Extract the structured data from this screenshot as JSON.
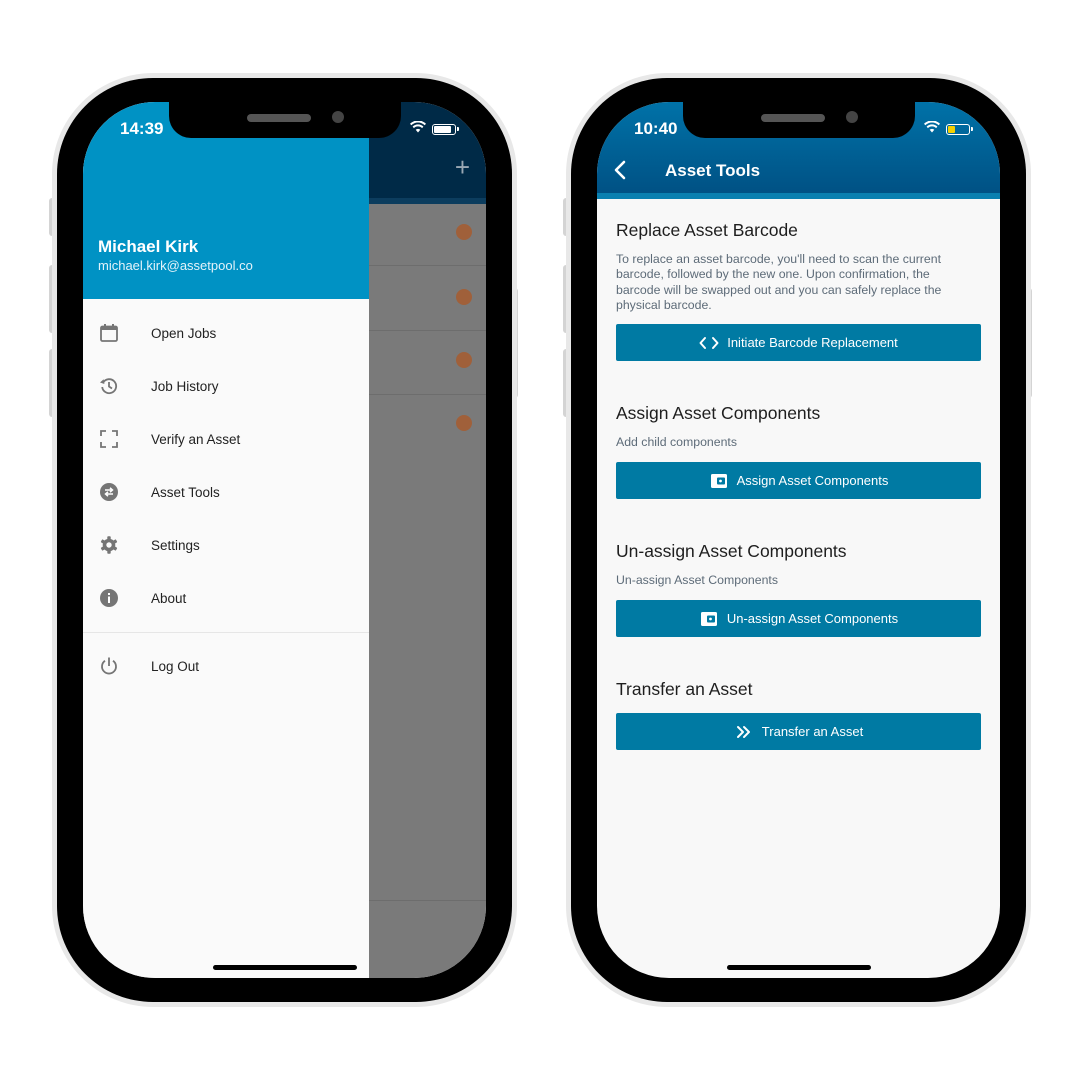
{
  "left_phone": {
    "status_time": "14:39",
    "drawer": {
      "user_name": "Michael Kirk",
      "user_email": "michael.kirk@assetpool.co",
      "menu": [
        {
          "label": "Open Jobs",
          "icon": "calendar-icon"
        },
        {
          "label": "Job History",
          "icon": "history-icon"
        },
        {
          "label": "Verify an Asset",
          "icon": "scan-frame-icon"
        },
        {
          "label": "Asset Tools",
          "icon": "swap-circle-icon"
        },
        {
          "label": "Settings",
          "icon": "gear-icon"
        },
        {
          "label": "About",
          "icon": "info-icon"
        }
      ],
      "logout": {
        "label": "Log Out",
        "icon": "power-icon"
      }
    }
  },
  "right_phone": {
    "status_time": "10:40",
    "header": {
      "title": "Asset Tools",
      "back_icon": "chevron-left-icon"
    },
    "sections": [
      {
        "title": "Replace Asset Barcode",
        "description": "To replace an asset barcode, you'll need to scan the current barcode, followed by the new one. Upon confirmation, the barcode will be swapped out and you can safely replace the physical barcode.",
        "button": {
          "label": "Initiate Barcode Replacement",
          "icon": "code-brackets-icon"
        }
      },
      {
        "title": "Assign Asset Components",
        "description": "Add child components",
        "button": {
          "label": "Assign Asset Components",
          "icon": "wallet-icon"
        }
      },
      {
        "title": "Un-assign Asset Components",
        "description": "Un-assign Asset Components",
        "button": {
          "label": "Un-assign Asset Components",
          "icon": "wallet-icon"
        }
      },
      {
        "title": "Transfer an Asset",
        "button": {
          "label": "Transfer an Asset",
          "icon": "double-chevron-right-icon"
        }
      }
    ]
  },
  "colors": {
    "drawer_header": "#0092c4",
    "app_header": "#005184",
    "button": "#007aa3",
    "accent_timer": "#a0603a",
    "battery_low": "#f5d000"
  }
}
